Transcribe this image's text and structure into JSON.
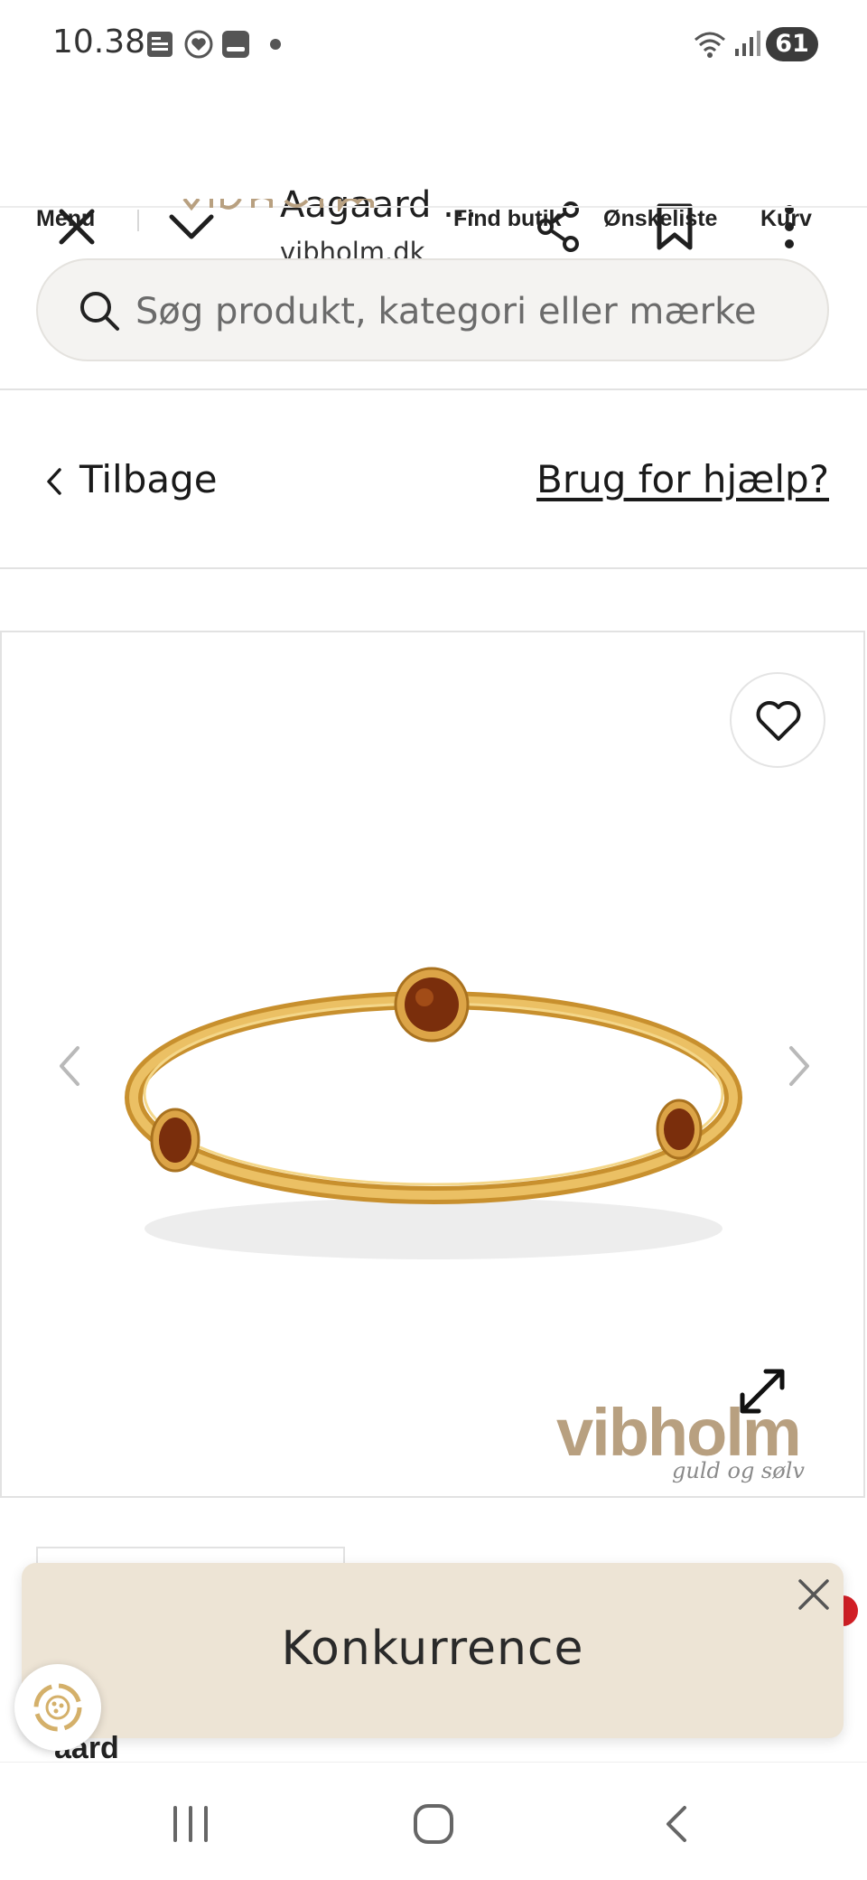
{
  "status_bar": {
    "time": "10.38",
    "battery": "61",
    "icons": [
      "sim-card-icon",
      "heart-monitor-icon",
      "tablet-icon",
      "dot-icon",
      "wifi-icon",
      "signal-icon"
    ]
  },
  "browser": {
    "title": "Aagaard ...",
    "domain": "vibholm.dk",
    "icons": [
      "close-icon",
      "chevron-down-icon",
      "share-icon",
      "bookmark-icon",
      "more-vert-icon"
    ]
  },
  "site_header": {
    "menu_label": "Menu",
    "find_store": "Find butik",
    "wishlist": "Ønskeliste",
    "cart": "Kurv",
    "search_placeholder": "Søg produkt, kategori eller mærke"
  },
  "product_nav": {
    "back_label": "Tilbage",
    "help_label": "Brug for hjælp?"
  },
  "product": {
    "image_description_icon": "gold-bangle-with-amber-stones",
    "brand_watermark": "vibholm",
    "brand_tagline": "guld og sølv",
    "name_partial": "aard"
  },
  "promo": {
    "label": "Konkurrence"
  },
  "colors": {
    "gold": "#d9a441",
    "amber": "#8b3a0e",
    "banner_bg": "#ede4d5",
    "logo_tan": "#b8a080"
  }
}
